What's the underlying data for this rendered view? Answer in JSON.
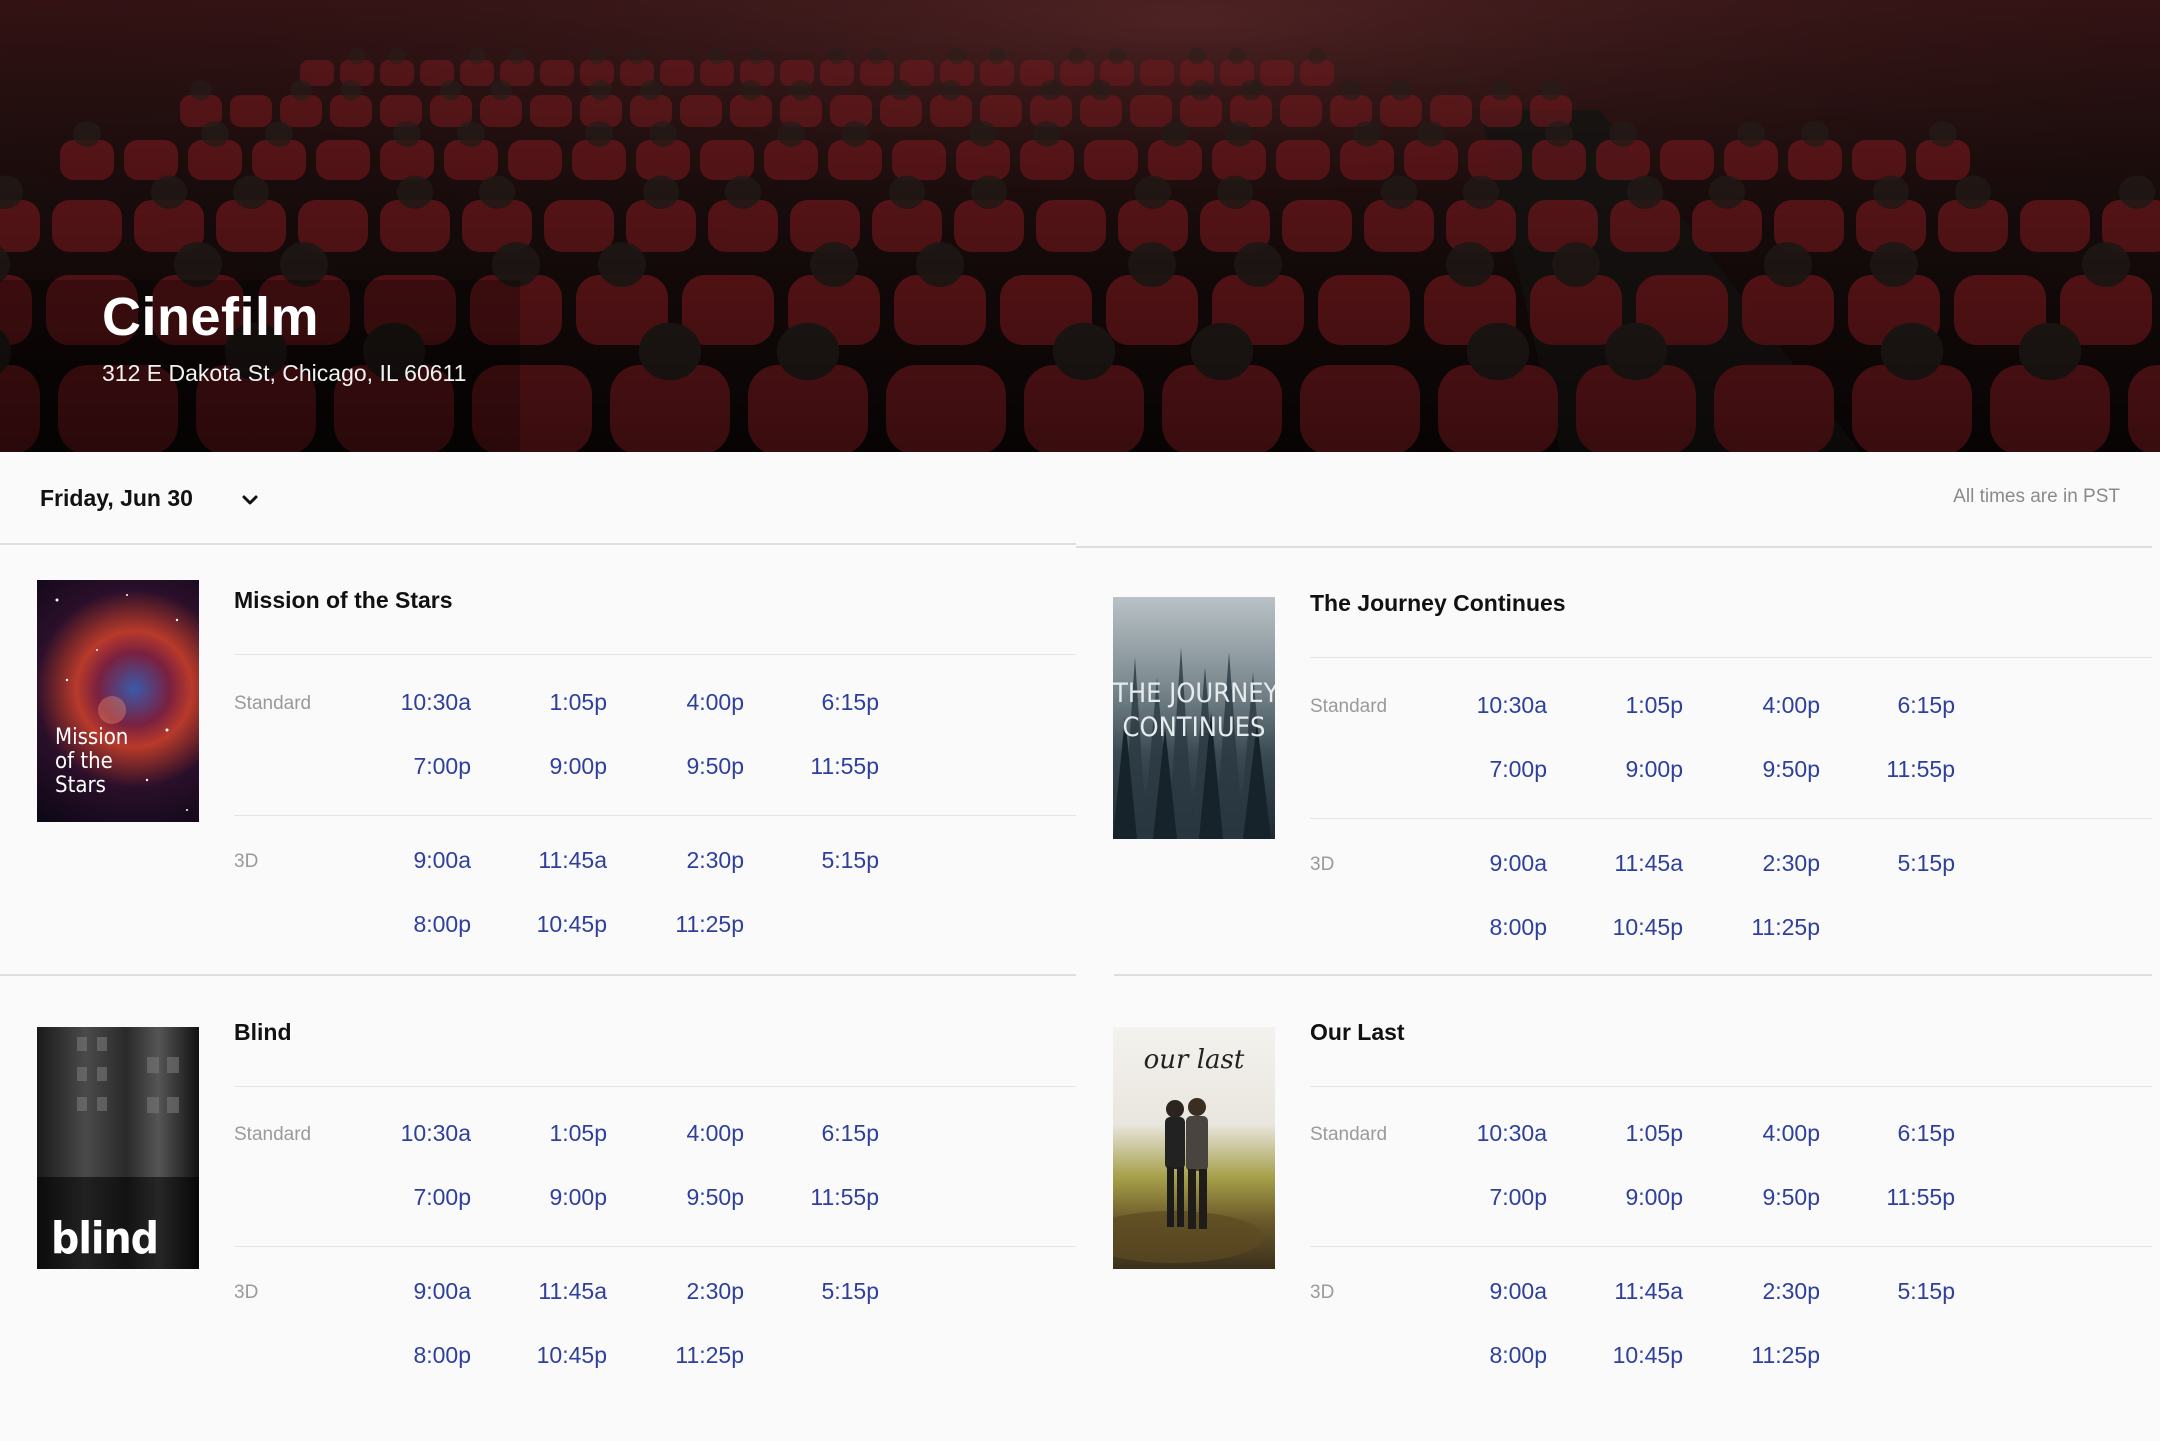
{
  "theater": {
    "name": "Cinefilm",
    "address": "312 E Dakota St, Chicago, IL 60611"
  },
  "date_selector": {
    "selected": "Friday, Jun 30"
  },
  "timezone_note": "All times are in PST",
  "accent_color": "#2e3f9c",
  "movies": [
    {
      "title": "Mission of the Stars",
      "poster_text": "Mission\nof the\nStars",
      "standard": [
        "10:30a",
        "1:05p",
        "4:00p",
        "6:15p",
        "7:00p",
        "9:00p",
        "9:50p",
        "11:55p"
      ],
      "threed": [
        "9:00a",
        "11:45a",
        "2:30p",
        "5:15p",
        "8:00p",
        "10:45p",
        "11:25p"
      ]
    },
    {
      "title": "The Journey Continues",
      "poster_text": "THE JOURNEY\nCONTINUES",
      "standard": [
        "10:30a",
        "1:05p",
        "4:00p",
        "6:15p",
        "7:00p",
        "9:00p",
        "9:50p",
        "11:55p"
      ],
      "threed": [
        "9:00a",
        "11:45a",
        "2:30p",
        "5:15p",
        "8:00p",
        "10:45p",
        "11:25p"
      ]
    },
    {
      "title": "Blind",
      "poster_text": "blind",
      "standard": [
        "10:30a",
        "1:05p",
        "4:00p",
        "6:15p",
        "7:00p",
        "9:00p",
        "9:50p",
        "11:55p"
      ],
      "threed": [
        "9:00a",
        "11:45a",
        "2:30p",
        "5:15p",
        "8:00p",
        "10:45p",
        "11:25p"
      ]
    },
    {
      "title": "Our Last",
      "poster_text": "our last",
      "standard": [
        "10:30a",
        "1:05p",
        "4:00p",
        "6:15p",
        "7:00p",
        "9:00p",
        "9:50p",
        "11:55p"
      ],
      "threed": [
        "9:00a",
        "11:45a",
        "2:30p",
        "5:15p",
        "8:00p",
        "10:45p",
        "11:25p"
      ]
    }
  ],
  "format_labels": {
    "standard": "Standard",
    "threed": "3D"
  }
}
